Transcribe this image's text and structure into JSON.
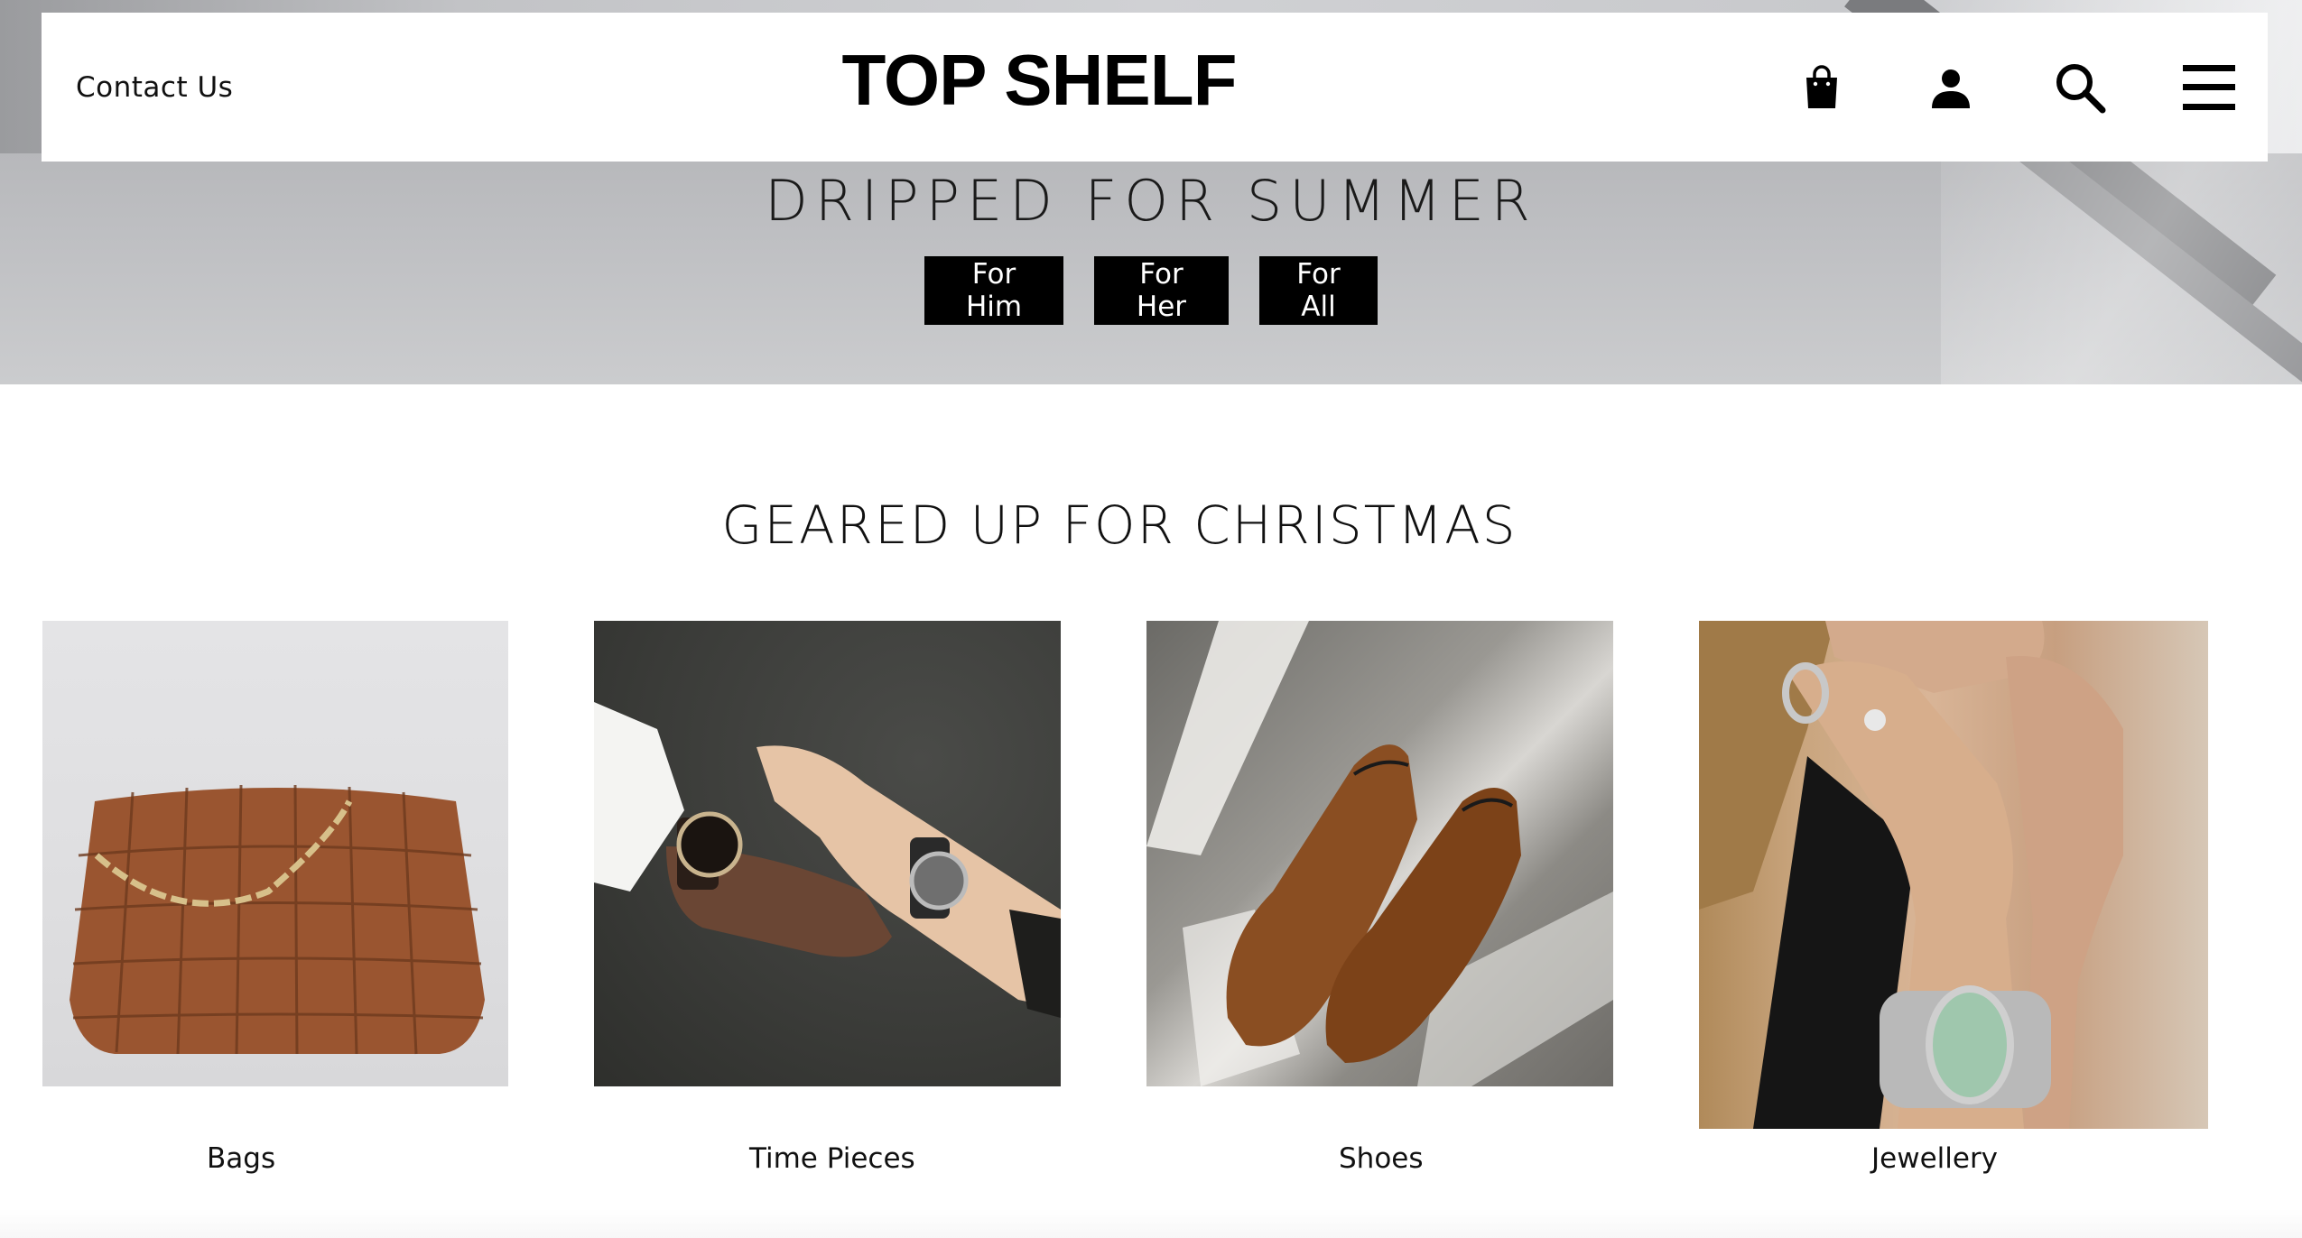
{
  "header": {
    "contact_label": "Contact Us",
    "logo": "TOP SHELF",
    "icons": [
      "shopping-bag-icon",
      "account-icon",
      "search-icon",
      "menu-icon"
    ]
  },
  "hero": {
    "title": "DRIPPED FOR SUMMER",
    "buttons": [
      {
        "label": "For Him"
      },
      {
        "label": "For Her"
      },
      {
        "label": "For All"
      }
    ]
  },
  "section": {
    "title": "GEARED UP FOR CHRISTMAS",
    "categories": [
      {
        "label": "Bags",
        "image": "leather-woven-bag"
      },
      {
        "label": "Time Pieces",
        "image": "wrist-watches"
      },
      {
        "label": "Shoes",
        "image": "brown-leather-oxfords"
      },
      {
        "label": "Jewellery",
        "image": "rings-and-bracelet"
      }
    ]
  },
  "colors": {
    "cta_background": "#000000",
    "cta_text": "#ffffff",
    "navbar_background": "#ffffff"
  }
}
